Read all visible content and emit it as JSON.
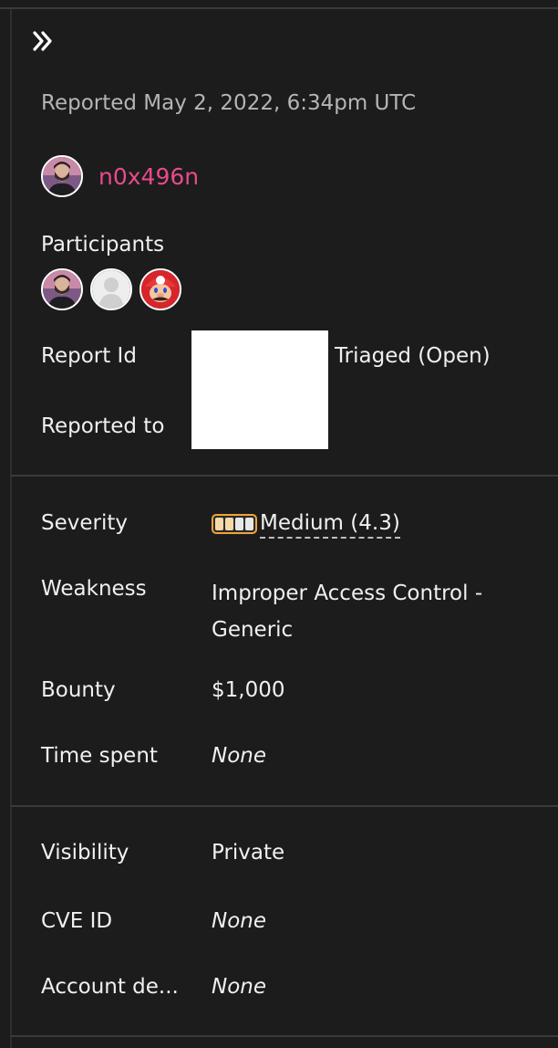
{
  "header": {
    "collapse_icon": "double-chevron-right-icon",
    "reported_line": "Reported May 2, 2022, 6:34pm UTC"
  },
  "reporter": {
    "name": "n0x496n",
    "name_color": "#e84a8a",
    "avatar_icon": "user-avatar-photo"
  },
  "participants": {
    "label": "Participants",
    "avatars": [
      "user-avatar-photo",
      "default-user-avatar",
      "mario-avatar"
    ]
  },
  "report": {
    "id_label": "Report Id",
    "status": "Triaged (Open)",
    "reported_to_label": "Reported to"
  },
  "details": {
    "severity_label": "Severity",
    "severity_value": "Medium (4.3)",
    "severity_level": {
      "filled": 2,
      "total": 4
    },
    "severity_color": "#f2a33a",
    "weakness_label": "Weakness",
    "weakness_value": "Improper Access Control - Generic",
    "bounty_label": "Bounty",
    "bounty_value": "$1,000",
    "time_spent_label": "Time spent",
    "time_spent_value": "None"
  },
  "meta": {
    "visibility_label": "Visibility",
    "visibility_value": "Private",
    "cve_label": "CVE ID",
    "cve_value": "None",
    "account_label": "Account de...",
    "account_value": "None"
  }
}
